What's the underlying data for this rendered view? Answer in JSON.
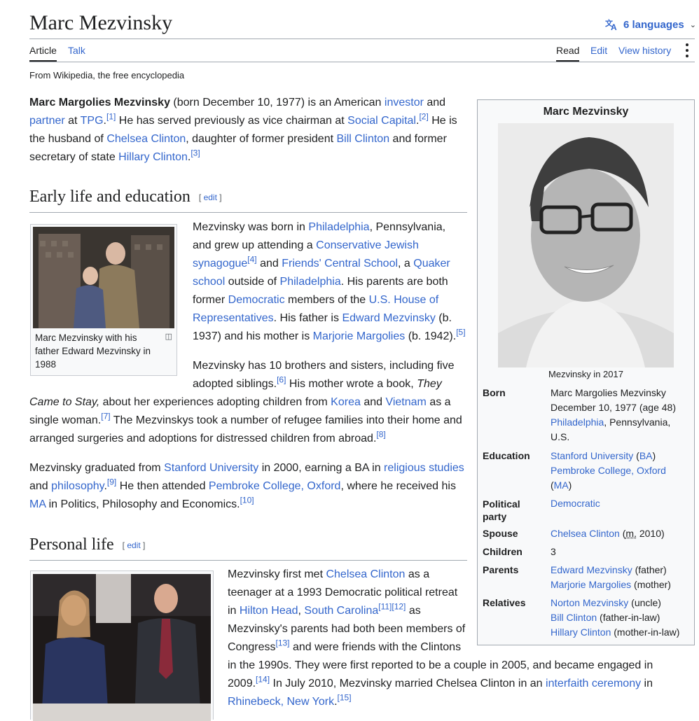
{
  "title": "Marc Mezvinsky",
  "languages": {
    "label": "6 languages"
  },
  "tabs": {
    "article": "Article",
    "talk": "Talk",
    "read": "Read",
    "edit": "Edit",
    "history": "View history"
  },
  "tagline": "From Wikipedia, the free encyclopedia",
  "lead": {
    "bold_name": "Marc Margolies Mezvinsky",
    "t1": " (born December 10, 1977) is an American ",
    "l_investor": "investor",
    "t2": " and ",
    "l_partner": "partner",
    "t3": " at ",
    "l_tpg": "TPG",
    "r1": "[1]",
    "t4": " He has served previously as vice chairman at ",
    "l_social": "Social Capital",
    "r2": "[2]",
    "t5": " He is the husband of ",
    "l_chelsea": "Chelsea Clinton",
    "t6": ", daughter of former president ",
    "l_bill": "Bill Clinton",
    "t7": " and former secretary of state ",
    "l_hillary": "Hillary Clinton",
    "r3": "[3]"
  },
  "section1": {
    "heading": "Early life and education",
    "edit_label": "edit",
    "thumb_caption": "Marc Mezvinsky with his father Edward Mezvinsky in 1988",
    "p1": {
      "t1": "Mezvinsky was born in ",
      "l_phil": "Philadelphia",
      "t2": ", Pennsylvania, and grew up attending a ",
      "l_cjs": "Conservative Jewish synagogue",
      "r4": "[4]",
      "t3": " and ",
      "l_fcs": "Friends' Central School",
      "t4": ", a ",
      "l_quaker": "Quaker school",
      "t5": " outside of ",
      "l_phil2": "Philadelphia",
      "t6": ". His parents are both former ",
      "l_dem": "Democratic",
      "t7": " members of the ",
      "l_house": "U.S. House of Representatives",
      "t8": ". His father is ",
      "l_edward": "Edward Mezvinsky",
      "t9": " (b. 1937) and his mother is ",
      "l_marjorie": "Marjorie Margolies",
      "t10": " (b. 1942).",
      "r5": "[5]"
    },
    "p2": {
      "t1": "Mezvinsky has 10 brothers and sisters, including five adopted siblings.",
      "r6": "[6]",
      "t2": " His mother wrote a book, ",
      "book": "They Came to Stay,",
      "t3": " about her experiences adopting children from ",
      "l_korea": "Korea",
      "t4": " and ",
      "l_vietnam": "Vietnam",
      "t5": " as a single woman.",
      "r7": "[7]",
      "t6": " The Mezvinskys took a number of refugee families into their home and arranged surgeries and adoptions for distressed children from abroad.",
      "r8": "[8]"
    },
    "p3": {
      "t1": "Mezvinsky graduated from ",
      "l_stanford": "Stanford University",
      "t2": " in 2000, earning a BA in ",
      "l_rel": "religious studies",
      "t3": " and ",
      "l_phil": "philosophy",
      "t4": ".",
      "r9": "[9]",
      "t5": " He then attended ",
      "l_pembroke": "Pembroke College, Oxford",
      "t6": ", where he received his ",
      "l_ma": "MA",
      "t7": " in Politics, Philosophy and Economics.",
      "r10": "[10]"
    }
  },
  "section2": {
    "heading": "Personal life",
    "edit_label": "edit",
    "p1": {
      "t1": "Mezvinsky first met ",
      "l_chelsea": "Chelsea Clinton",
      "t2": " as a teenager at a 1993 Democratic political retreat in ",
      "l_hilton": "Hilton Head",
      "t3": ", ",
      "l_sc": "South Carolina",
      "r11": "[11]",
      "r12": "[12]",
      "t4": " as Mezvinsky's parents had both been members of Congress",
      "r13": "[13]",
      "t5": " and were friends with the Clintons in the 1990s. They were first reported to be a couple in 2005, and became engaged in 2009.",
      "r14": "[14]",
      "t6": " In July 2010, Mezvinsky married Chelsea Clinton in an ",
      "l_interfaith": "interfaith ceremony",
      "t7": " in ",
      "l_rhinebeck": "Rhinebeck, New York",
      "t8": ".",
      "r15": "[15]"
    }
  },
  "infobox": {
    "title": "Marc Mezvinsky",
    "caption": "Mezvinsky in 2017",
    "born": {
      "label": "Born",
      "name": "Marc Margolies Mezvinsky",
      "date": "December 10, 1977 (age 48)",
      "l_place": "Philadelphia",
      "place_rest": ", Pennsylvania, U.S."
    },
    "education": {
      "label": "Education",
      "l_stanford": "Stanford University",
      "open1": " (",
      "l_ba": "BA",
      "close1": ")",
      "l_pembroke": "Pembroke College, Oxford",
      "open2": " (",
      "l_ma": "MA",
      "close2": ")"
    },
    "party": {
      "label": "Political party",
      "l_value": "Democratic"
    },
    "spouse": {
      "label": "Spouse",
      "l_value": "Chelsea Clinton",
      "extra_open": " (",
      "m": "m.",
      "extra_close": " 2010)"
    },
    "children": {
      "label": "Children",
      "value": "3"
    },
    "parents": {
      "label": "Parents",
      "l_father": "Edward Mezvinsky",
      "father_note": " (father)",
      "l_mother": "Marjorie Margolies",
      "mother_note": " (mother)"
    },
    "relatives": {
      "label": "Relatives",
      "l_norton": "Norton Mezvinsky",
      "norton_note": " (uncle)",
      "l_bill": "Bill Clinton",
      "bill_note": " (father-in-law)",
      "l_hillary": "Hillary Clinton",
      "hillary_note": " (mother-in-law)"
    }
  }
}
